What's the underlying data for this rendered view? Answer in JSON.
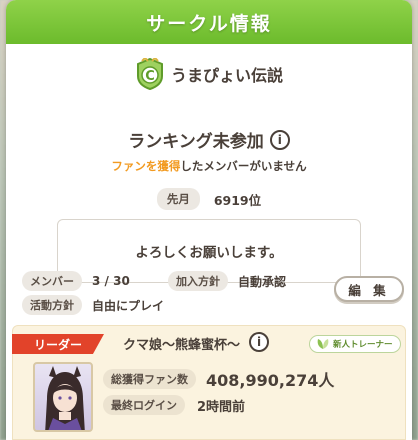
{
  "dialog": {
    "title": "サークル情報"
  },
  "club": {
    "name": "うまぴょい伝説",
    "rank_letter": "C"
  },
  "ranking": {
    "status": "ランキング未参加",
    "note_highlight": "ファンを獲得",
    "note_rest": "したメンバーがいません",
    "last_month_label": "先月",
    "last_month_value": "6919位"
  },
  "message": "よろしくお願いします。",
  "info": {
    "members_label": "メンバー",
    "members_value": "3 / 30",
    "join_policy_label": "加入方針",
    "join_policy_value": "自動承認",
    "activity_label": "活動方針",
    "activity_value": "自由にプレイ",
    "edit_label": "編 集"
  },
  "leader": {
    "tag": "リーダー",
    "name": "クマ娘～熊蜂蜜杯～",
    "badge": "新人トレーナー",
    "fans_label": "総獲得ファン数",
    "fans_value": "408,990,274人",
    "last_login_label": "最終ログイン",
    "last_login_value": "2時間前"
  },
  "colors": {
    "title_green": "#7cc33a",
    "accent_orange": "#f29a20",
    "leader_red": "#e2432a"
  }
}
